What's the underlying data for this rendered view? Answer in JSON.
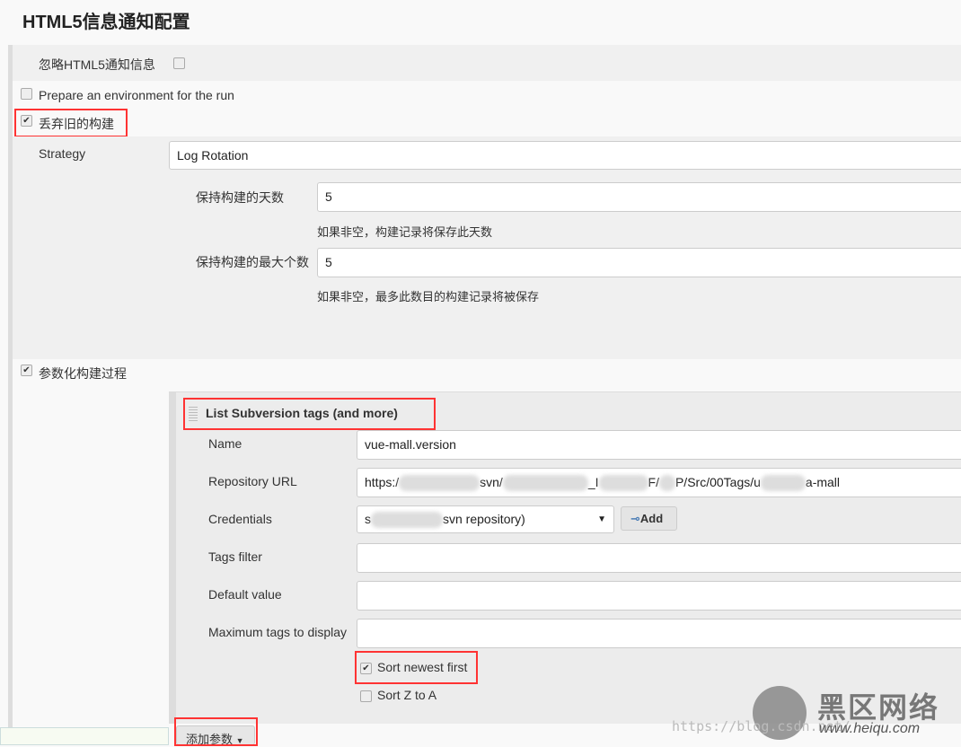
{
  "title": "HTML5信息通知配置",
  "ignore_html5": {
    "label": "忽略HTML5通知信息",
    "checked": false
  },
  "prepare_env": {
    "label": "Prepare an environment for the run",
    "checked": false
  },
  "discard_old": {
    "label": "丢弃旧的构建",
    "checked": true
  },
  "strategy": {
    "label": "Strategy",
    "value": "Log Rotation"
  },
  "days_to_keep": {
    "label": "保持构建的天数",
    "value": "5",
    "help": "如果非空，构建记录将保存此天数"
  },
  "max_builds": {
    "label": "保持构建的最大个数",
    "value": "5",
    "help": "如果非空，最多此数目的构建记录将被保存"
  },
  "parameterized": {
    "label": "参数化构建过程",
    "checked": true
  },
  "param_panel": {
    "title": "List Subversion tags (and more)",
    "name": {
      "label": "Name",
      "value": "vue-mall.version"
    },
    "repo_url": {
      "label": "Repository URL",
      "value_parts": [
        "https:/",
        "svn/",
        "_I",
        "F/",
        "P/Src/00Tags/u",
        "a-mall"
      ]
    },
    "credentials": {
      "label": "Credentials",
      "value_parts": [
        "s",
        "svn repository)"
      ],
      "add_label": "Add"
    },
    "tags_filter": {
      "label": "Tags filter",
      "value": ""
    },
    "default_value": {
      "label": "Default value",
      "value": ""
    },
    "max_tags": {
      "label": "Maximum tags to display",
      "value": ""
    },
    "sort_newest": {
      "label": "Sort newest first",
      "checked": true
    },
    "sort_z_a": {
      "label": "Sort Z to A",
      "checked": false
    }
  },
  "add_param_label": "添加参数",
  "watermark": {
    "brand": "黑区网络",
    "url": "www.heiqu.com",
    "blog": "https://blog.csdn.net/"
  }
}
